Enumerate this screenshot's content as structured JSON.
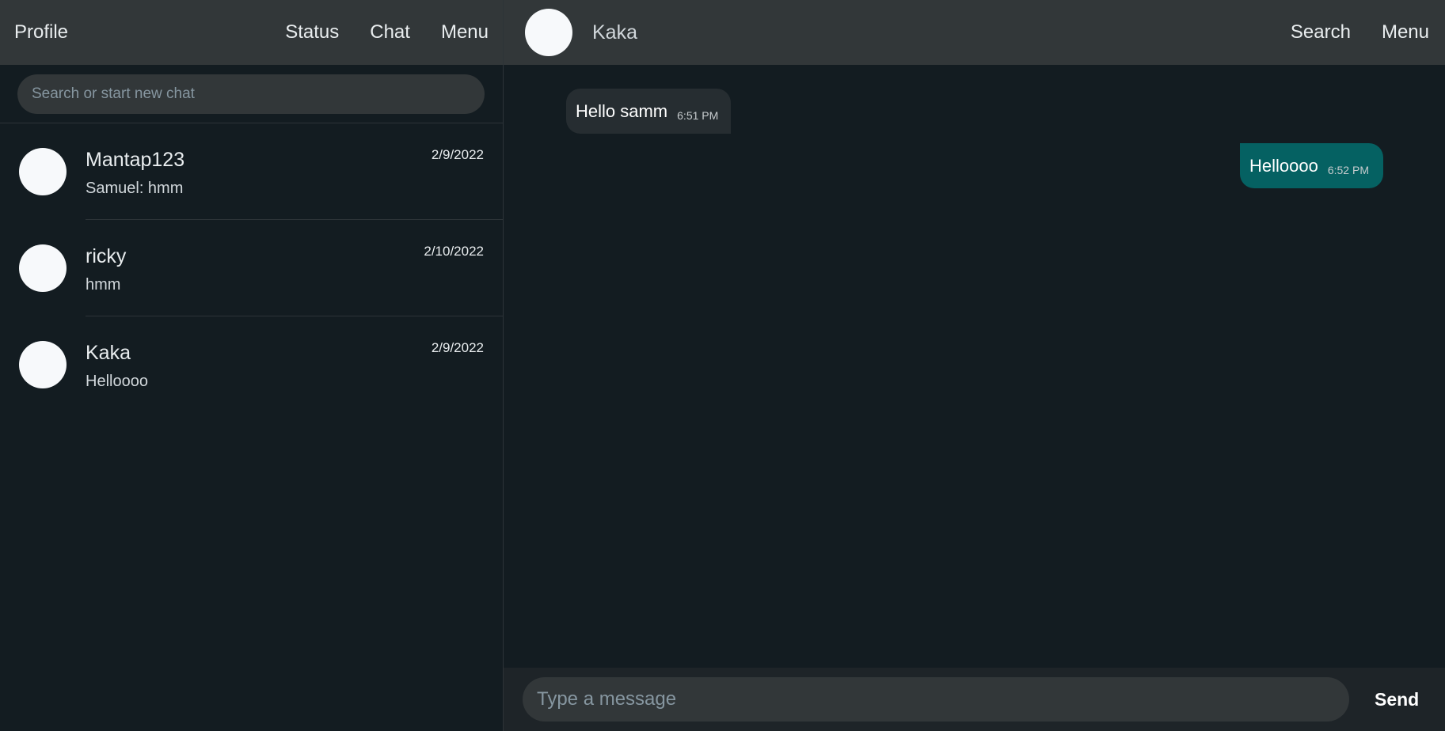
{
  "sidebar": {
    "profile_label": "Profile",
    "nav": [
      "Status",
      "Chat",
      "Menu"
    ],
    "search_placeholder": "Search or start new chat",
    "chats": [
      {
        "name": "Mantap123",
        "preview": "Samuel: hmm",
        "date": "2/9/2022"
      },
      {
        "name": "ricky",
        "preview": "hmm",
        "date": "2/10/2022"
      },
      {
        "name": "Kaka",
        "preview": "Helloooo",
        "date": "2/9/2022"
      }
    ]
  },
  "conversation": {
    "contact_name": "Kaka",
    "nav": [
      "Search",
      "Menu"
    ],
    "messages": [
      {
        "text": "Hello samm",
        "time": "6:51 PM",
        "direction": "incoming"
      },
      {
        "text": "Helloooo",
        "time": "6:52 PM",
        "direction": "outgoing"
      }
    ],
    "input_placeholder": "Type a message",
    "send_label": "Send"
  },
  "colors": {
    "background": "#131c21",
    "header": "#323739",
    "incoming_bubble": "#262d31",
    "outgoing_bubble": "#056162"
  }
}
